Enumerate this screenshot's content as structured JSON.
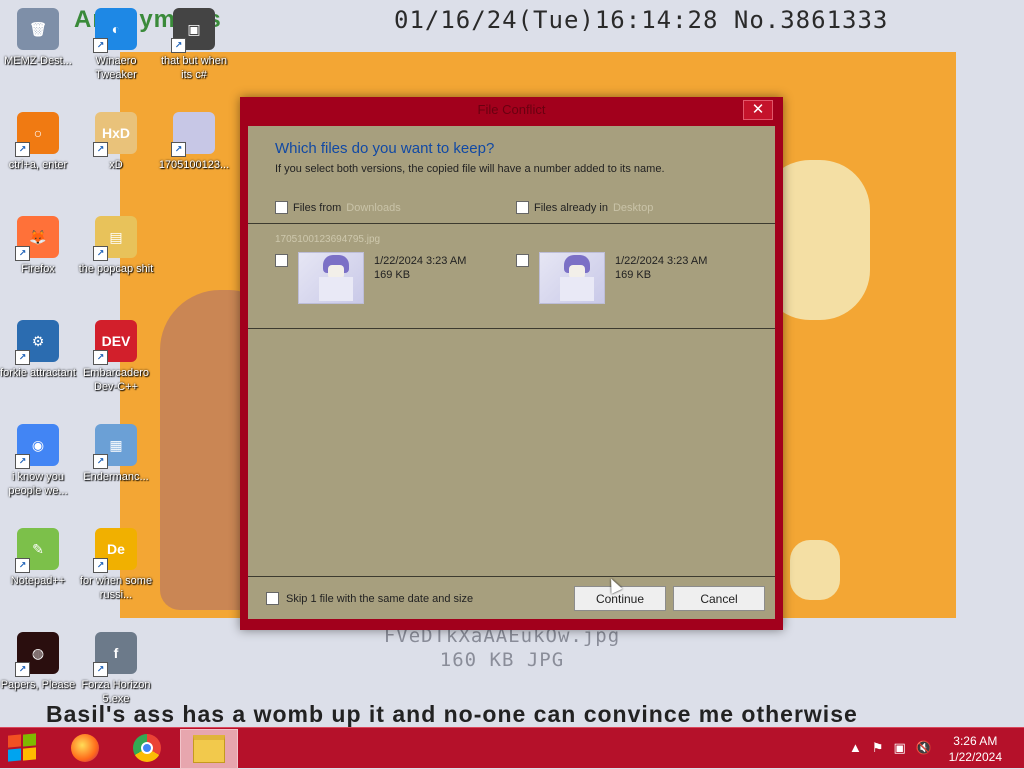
{
  "wallpaper": {
    "poster_name": "Anonymous",
    "post_stamp": "01/16/24(Tue)16:14:28 No.3861333",
    "file_name": "FVeDTkXaAAEukOw.jpg",
    "file_meta": "160 KB JPG",
    "post_text": "Basil's ass has a womb up it and no-one can convince me otherwise"
  },
  "desktop_icons": [
    {
      "label": "MEMZ-Dest...",
      "icon": "recycle-bin-icon",
      "color": "#7e8fa8",
      "glyph": "🗑"
    },
    {
      "label": "Winaero Tweaker",
      "icon": "winaero-icon",
      "color": "#1e88e5",
      "glyph": "◐"
    },
    {
      "label": "that but when its c#",
      "icon": "stacked-windows-icon",
      "color": "#444444",
      "glyph": "▣"
    },
    {
      "label": "ctrl+a, enter",
      "icon": "magnifier-icon",
      "color": "#f07a12",
      "glyph": "○"
    },
    {
      "label": "xD",
      "icon": "hxd-icon",
      "color": "#e9c27a",
      "glyph": "HxD"
    },
    {
      "label": "1705100123...",
      "icon": "image-thumbnail-icon",
      "color": "#c7c7e6",
      "glyph": ""
    },
    {
      "label": "Firefox",
      "icon": "firefox-icon",
      "color": "#ff7139",
      "glyph": "🦊"
    },
    {
      "label": "the popcap shit",
      "icon": "folder-icon",
      "color": "#e8c25a",
      "glyph": "▤"
    },
    {
      "label": "forkie attractant",
      "icon": "monitor-gear-icon",
      "color": "#2b6cb0",
      "glyph": "⚙"
    },
    {
      "label": "Embarcadero Dev-C++",
      "icon": "devcpp-icon",
      "color": "#d21f2b",
      "glyph": "DEV"
    },
    {
      "label": "i know you people we...",
      "icon": "chrome-icon",
      "color": "#4285f4",
      "glyph": "◉"
    },
    {
      "label": "Endermanc...",
      "icon": "window-app-icon",
      "color": "#6ba0d6",
      "glyph": "▦"
    },
    {
      "label": "Notepad++",
      "icon": "notepadpp-icon",
      "color": "#7cc04a",
      "glyph": "✎"
    },
    {
      "label": "for when some russi...",
      "icon": "de-icon",
      "color": "#f1b000",
      "glyph": "De"
    },
    {
      "label": "Papers, Please",
      "icon": "papers-please-icon",
      "color": "#2a0e0e",
      "glyph": "◍"
    },
    {
      "label": "Forza Horizon 5.exe",
      "icon": "flash-icon",
      "color": "#6c7a8a",
      "glyph": "f"
    }
  ],
  "dialog": {
    "title": "File Conflict",
    "close_glyph": "✕",
    "heading": "Which files do you want to keep?",
    "subtext": "If you select both versions, the copied file will have a number added to its name.",
    "left_column": {
      "prefix": "Files from",
      "source": "Downloads"
    },
    "right_column": {
      "prefix": "Files already in",
      "source": "Desktop"
    },
    "file_name": "1705100123694795.jpg",
    "left_file": {
      "date": "1/22/2024 3:23 AM",
      "size": "169 KB"
    },
    "right_file": {
      "date": "1/22/2024 3:23 AM",
      "size": "169 KB"
    },
    "skip_label": "Skip 1 file with the same date and size",
    "continue_label": "Continue",
    "cancel_label": "Cancel",
    "accent": "#a2001c",
    "heading_color": "#1149a4"
  },
  "taskbar": {
    "apps": [
      {
        "name": "firefox",
        "icon": "firefox-icon"
      },
      {
        "name": "chrome",
        "icon": "chrome-icon"
      },
      {
        "name": "file-explorer",
        "icon": "file-explorer-icon",
        "active": true
      }
    ],
    "tray_icons": [
      "show-hidden-icons",
      "action-center-flag-icon",
      "network-icon",
      "volume-muted-icon"
    ],
    "time": "3:26 AM",
    "date": "1/22/2024",
    "color": "#b5112a"
  }
}
